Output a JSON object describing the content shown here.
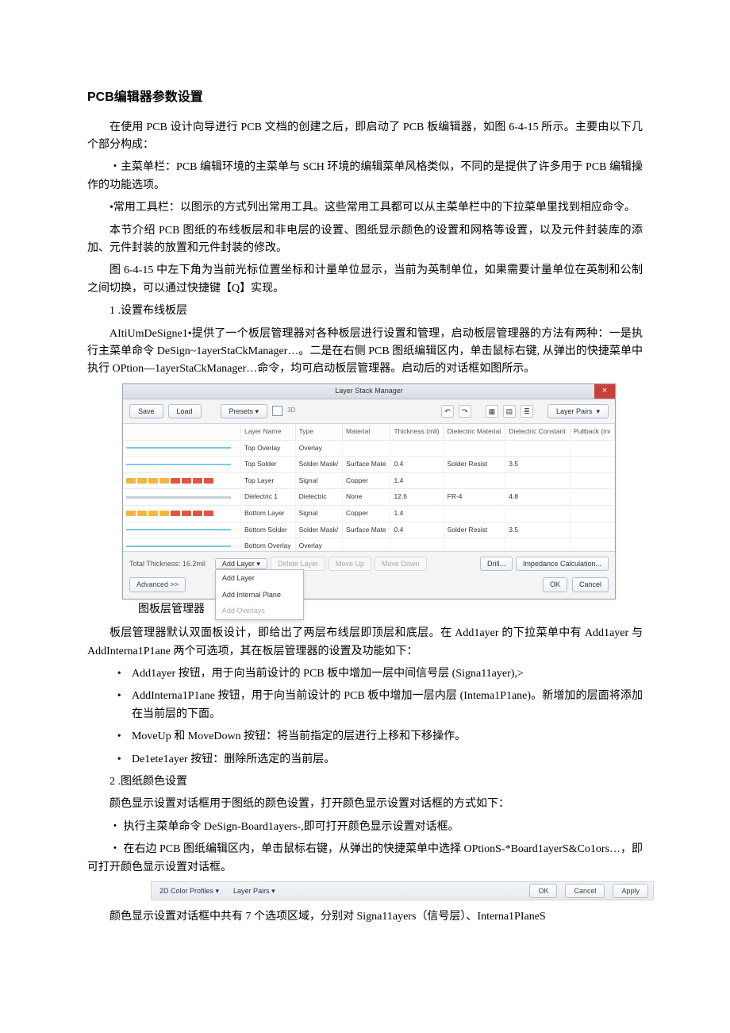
{
  "title": "PCB编辑器参数设置",
  "paras": {
    "p1": "在使用 PCB 设计向导进行 PCB 文档的创建之后，即启动了 PCB 板编辑器，如图 6-4-15 所示。主要由以下几个部分构成：",
    "p2": "・主菜单栏：PCB 编辑环境的主菜单与 SCH 环境的编辑菜单风格类似，不同的是提供了许多用于 PCB 编辑操作的功能选项。",
    "p3": "•常用工具栏：以图示的方式列出常用工具。这些常用工具都可以从主菜单栏中的下拉菜单里找到相应命令。",
    "p4": "本节介绍 PCB 图纸的布线板层和非电层的设置、图纸显示颜色的设置和网格等设置，以及元件封装库的添加、元件封装的放置和元件封装的修改。",
    "p5": "图 6-4-15 中左下角为当前光标位置坐标和计量单位显示，当前为英制单位，如果需要计量单位在英制和公制之间切换，可以通过快捷键【Q】实现。",
    "p6": "1 .设置布线板层",
    "p7": "AItiUmDeSigne1•提供了一个板层管理器对各种板层进行设置和管理，启动板层管理器的方法有两种：一是执行主菜单命令 DeSign~1ayerStaCkManager…。二是在右侧 PCB 图纸编辑区内，单击鼠标右键, 从弹出的快捷菜单中执行 OPtion—1ayerStaCkManager…命令，均可启动板层管理器。启动后的对话框如图所示。",
    "caption1": "图板层管理器",
    "p8": "板层管理器默认双面板设计，即给出了两层布线层即顶层和底层。在 Add1ayer 的下拉菜单中有 Add1ayer 与 AddInterna1P1ane 两个可选项，其在板层管理器的设置及功能如下：",
    "b1": "Add1ayer 按钮，用于向当前设计的 PCB 板中增加一层中间信号层 (Signa11ayer),>",
    "b2": "AddInterna1P1ane 按钮，用于向当前设计的 PCB 板中增加一层内层 (Intema1P1ane)。新增加的层面将添加在当前层的下面。",
    "b3": "MoveUp 和 MoveDown 按钮：将当前指定的层进行上移和下移操作。",
    "b4": "De1ete1ayer 按钮：删除所选定的当前层。",
    "p9": "2 .图纸颜色设置",
    "p10": "颜色显示设置对话框用于图纸的颜色设置，打开颜色显示设置对话框的方式如下：",
    "p11": "・ 执行主菜单命令 DeSign-Board1ayers-,即可打开颜色显示设置对话框。",
    "p12": "・ 在右边 PCB 图纸编辑区内，单击鼠标右键，从弹出的快捷菜单中选择 OPtionS-*Board1ayerS&Co1ors…，即可打开颜色显示设置对话框。",
    "p13": "颜色显示设置对话框中共有 7 个选项区域，分别对 Signa11ayers（信号层）、Interna1PIaneS"
  },
  "lsm": {
    "title": "Layer Stack Manager",
    "save": "Save",
    "load": "Load",
    "presets": "Presets ▾",
    "threeD": "3D",
    "layerPairs": "Layer Pairs",
    "headers": [
      "",
      "Layer Name",
      "Type",
      "Material",
      "Thickness (mil)",
      "Dielectric Material",
      "Dielectric Constant",
      "Pullback (mi"
    ],
    "rows": [
      {
        "preview": "line",
        "name": "Top Overlay",
        "type": "Overlay",
        "mat": "",
        "thk": "",
        "dmat": "",
        "dc": "",
        "pb": ""
      },
      {
        "preview": "line",
        "name": "Top Solder",
        "type": "Solder Mask/",
        "mat": "Surface Mate",
        "thk": "0.4",
        "dmat": "Solder Resist",
        "dc": "3.5",
        "pb": ""
      },
      {
        "preview": "segs",
        "segcolors": [
          "#f4b63f",
          "#f4b63f",
          "#f4b63f",
          "#f4b63f",
          "#e05545",
          "#e05545",
          "#e05545",
          "#e05545"
        ],
        "name": "Top Layer",
        "type": "Signal",
        "mat": "Copper",
        "thk": "1.4",
        "dmat": "",
        "dc": "",
        "pb": ""
      },
      {
        "preview": "core",
        "name": "Dielectric 1",
        "type": "Dielectric",
        "mat": "None",
        "thk": "12.6",
        "dmat": "FR-4",
        "dc": "4.8",
        "pb": ""
      },
      {
        "preview": "segs",
        "segcolors": [
          "#f4b63f",
          "#f4b63f",
          "#f4b63f",
          "#f4b63f",
          "#e05545",
          "#e05545",
          "#e05545",
          "#e05545"
        ],
        "name": "Bottom Layer",
        "type": "Signal",
        "mat": "Copper",
        "thk": "1.4",
        "dmat": "",
        "dc": "",
        "pb": ""
      },
      {
        "preview": "line",
        "name": "Bottom Solder",
        "type": "Solder Mask/",
        "mat": "Surface Mate",
        "thk": "0.4",
        "dmat": "Solder Resist",
        "dc": "3.5",
        "pb": ""
      },
      {
        "preview": "line",
        "name": "Bottom Overlay",
        "type": "Overlay",
        "mat": "",
        "thk": "",
        "dmat": "",
        "dc": "",
        "pb": ""
      }
    ],
    "thickness": "Total Thickness: 16.2mil",
    "addLayer": "Add Layer ▾",
    "deleteLayer": "Delete Layer",
    "moveUp": "Move Up",
    "moveDown": "Move Down",
    "drill": "Drill...",
    "impCalc": "Impedance Calculation...",
    "menu": {
      "a": "Add Layer",
      "b": "Add Internal Plane",
      "c": "Add Overlays"
    },
    "advanced": "Advanced >>",
    "ok": "OK",
    "cancel": "Cancel"
  },
  "colorbar": {
    "tab1": "2D Color Profiles ▾",
    "tab2": "Layer Pairs ▾",
    "ok": "OK",
    "cancel": "Cancel",
    "apply": "Apply"
  }
}
